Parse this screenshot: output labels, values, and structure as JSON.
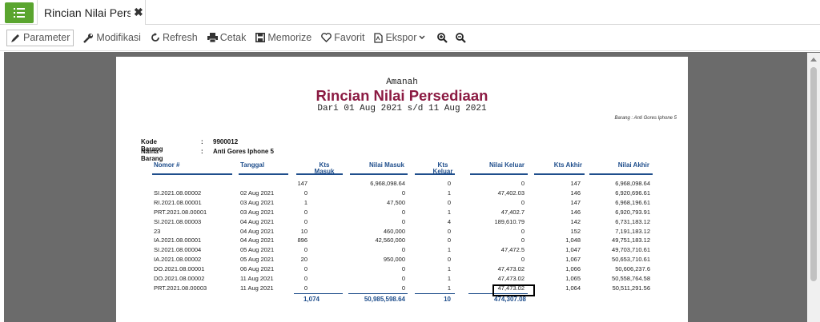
{
  "tab": {
    "title": "Rincian Nilai Pers…",
    "close": "✖",
    "menu_icon": "list-icon"
  },
  "toolbar": {
    "parameter": "Parameter",
    "modifikasi": "Modifikasi",
    "refresh": "Refresh",
    "cetak": "Cetak",
    "memorize": "Memorize",
    "favorit": "Favorit",
    "ekspor": "Ekspor"
  },
  "report": {
    "company": "Amanah",
    "title": "Rincian Nilai Persediaan",
    "period": "Dari 01 Aug 2021 s/d 11 Aug 2021",
    "filter": "Barang : Anti Gores Iphone 5",
    "kode_label": "Kode Barang",
    "kode_sep": ":",
    "kode_value": "9900012",
    "nama_label": "Nama Barang",
    "nama_sep": ":",
    "nama_value": "Anti Gores Iphone 5",
    "headers": {
      "nomor": "Nomor #",
      "tanggal": "Tanggal",
      "kts_masuk_1": "Kts",
      "kts_masuk_2": "Masuk",
      "nilai_masuk": "Nilai Masuk",
      "kts_keluar_1": "Kts",
      "kts_keluar_2": "Keluar",
      "nilai_keluar": "Nilai Keluar",
      "kts_akhir": "Kts Akhir",
      "nilai_akhir": "Nilai Akhir"
    },
    "rows": [
      {
        "nomor": "",
        "tanggal": "",
        "kts_masuk": "147",
        "nilai_masuk": "6,968,098.64",
        "kts_keluar": "0",
        "nilai_keluar": "0",
        "kts_akhir": "147",
        "nilai_akhir": "6,968,098.64"
      },
      {
        "nomor": "SI.2021.08.00002",
        "tanggal": "02 Aug 2021",
        "kts_masuk": "0",
        "nilai_masuk": "0",
        "kts_keluar": "1",
        "nilai_keluar": "47,402.03",
        "kts_akhir": "146",
        "nilai_akhir": "6,920,696.61"
      },
      {
        "nomor": "RI.2021.08.00001",
        "tanggal": "03 Aug 2021",
        "kts_masuk": "1",
        "nilai_masuk": "47,500",
        "kts_keluar": "0",
        "nilai_keluar": "0",
        "kts_akhir": "147",
        "nilai_akhir": "6,968,196.61"
      },
      {
        "nomor": "PRT.2021.08.00001",
        "tanggal": "03 Aug 2021",
        "kts_masuk": "0",
        "nilai_masuk": "0",
        "kts_keluar": "1",
        "nilai_keluar": "47,402.7",
        "kts_akhir": "146",
        "nilai_akhir": "6,920,793.91"
      },
      {
        "nomor": "SI.2021.08.00003",
        "tanggal": "04 Aug 2021",
        "kts_masuk": "0",
        "nilai_masuk": "0",
        "kts_keluar": "4",
        "nilai_keluar": "189,610.79",
        "kts_akhir": "142",
        "nilai_akhir": "6,731,183.12"
      },
      {
        "nomor": "23",
        "tanggal": "04 Aug 2021",
        "kts_masuk": "10",
        "nilai_masuk": "460,000",
        "kts_keluar": "0",
        "nilai_keluar": "0",
        "kts_akhir": "152",
        "nilai_akhir": "7,191,183.12"
      },
      {
        "nomor": "IA.2021.08.00001",
        "tanggal": "04 Aug 2021",
        "kts_masuk": "896",
        "nilai_masuk": "42,560,000",
        "kts_keluar": "0",
        "nilai_keluar": "0",
        "kts_akhir": "1,048",
        "nilai_akhir": "49,751,183.12"
      },
      {
        "nomor": "SI.2021.08.00004",
        "tanggal": "05 Aug 2021",
        "kts_masuk": "0",
        "nilai_masuk": "0",
        "kts_keluar": "1",
        "nilai_keluar": "47,472.5",
        "kts_akhir": "1,047",
        "nilai_akhir": "49,703,710.61"
      },
      {
        "nomor": "IA.2021.08.00002",
        "tanggal": "05 Aug 2021",
        "kts_masuk": "20",
        "nilai_masuk": "950,000",
        "kts_keluar": "0",
        "nilai_keluar": "0",
        "kts_akhir": "1,067",
        "nilai_akhir": "50,653,710.61"
      },
      {
        "nomor": "DO.2021.08.00001",
        "tanggal": "06 Aug 2021",
        "kts_masuk": "0",
        "nilai_masuk": "0",
        "kts_keluar": "1",
        "nilai_keluar": "47,473.02",
        "kts_akhir": "1,066",
        "nilai_akhir": "50,606,237.6"
      },
      {
        "nomor": "DO.2021.08.00002",
        "tanggal": "11 Aug 2021",
        "kts_masuk": "0",
        "nilai_masuk": "0",
        "kts_keluar": "1",
        "nilai_keluar": "47,473.02",
        "kts_akhir": "1,065",
        "nilai_akhir": "50,558,764.58"
      },
      {
        "nomor": "PRT.2021.08.00003",
        "tanggal": "11 Aug 2021",
        "kts_masuk": "0",
        "nilai_masuk": "0",
        "kts_keluar": "1",
        "nilai_keluar": "47,473.02",
        "kts_akhir": "1,064",
        "nilai_akhir": "50,511,291.56"
      }
    ],
    "totals": {
      "kts_masuk": "1,074",
      "nilai_masuk": "50,985,598.64",
      "kts_keluar": "10",
      "nilai_keluar": "474,307.08"
    }
  }
}
